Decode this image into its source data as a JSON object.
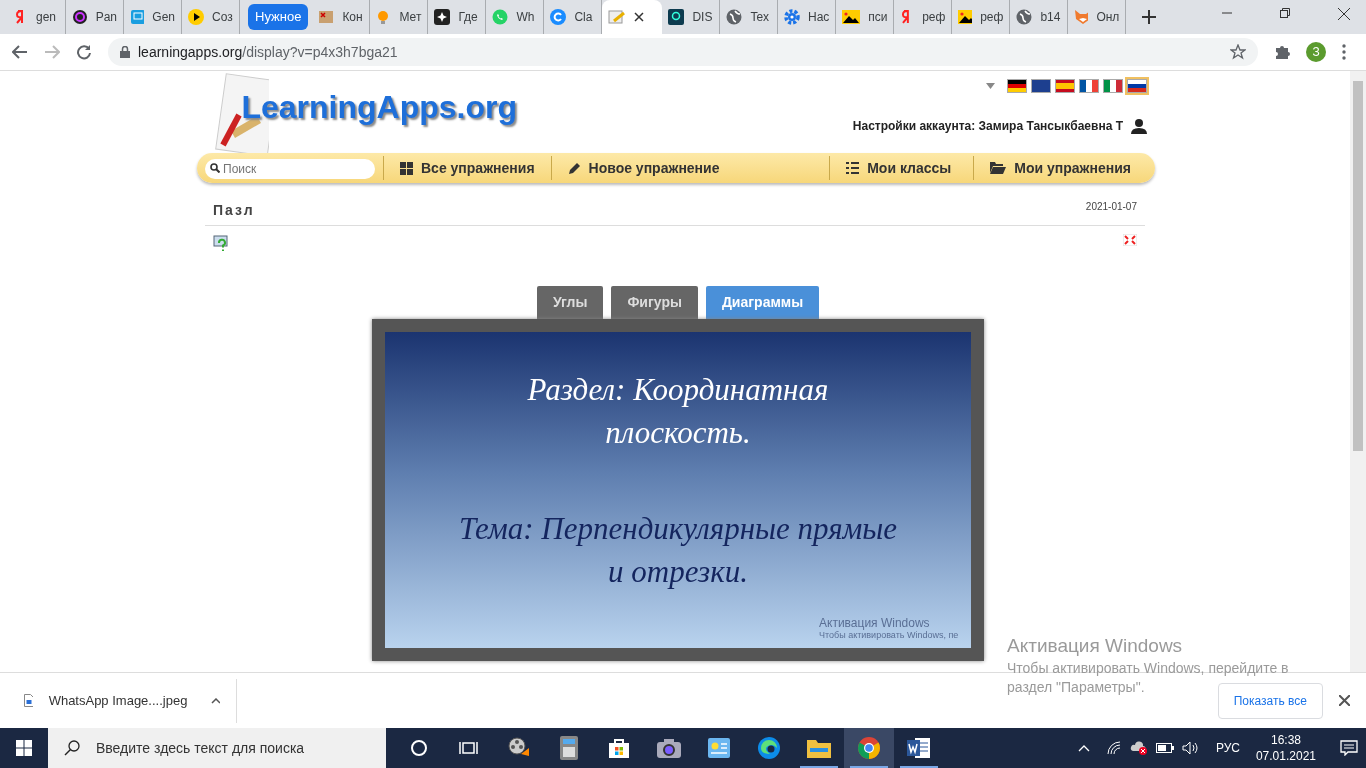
{
  "browser": {
    "tabs": [
      {
        "kind": "tab",
        "label": "gen",
        "selected": false
      },
      {
        "kind": "tab",
        "label": "Pan",
        "selected": false
      },
      {
        "kind": "tab",
        "label": "Gen",
        "selected": false
      },
      {
        "kind": "tab",
        "label": "Соз",
        "selected": false
      },
      {
        "kind": "group",
        "label": "Нужное"
      },
      {
        "kind": "tab",
        "label": "Кон",
        "selected": false
      },
      {
        "kind": "tab",
        "label": "Мет",
        "selected": false
      },
      {
        "kind": "tab",
        "label": "Где",
        "selected": false
      },
      {
        "kind": "tab",
        "label": "Wh",
        "selected": false
      },
      {
        "kind": "tab",
        "label": "Cla",
        "selected": false
      },
      {
        "kind": "tab",
        "selected": true
      },
      {
        "kind": "tab",
        "label": "DIS",
        "selected": false
      },
      {
        "kind": "tab",
        "label": "Tex",
        "selected": false
      },
      {
        "kind": "tab",
        "label": "Нас",
        "selected": false
      },
      {
        "kind": "tab",
        "label": "пси",
        "selected": false
      },
      {
        "kind": "tab",
        "label": "реф",
        "selected": false
      },
      {
        "kind": "tab",
        "label": "реф",
        "selected": false
      },
      {
        "kind": "tab",
        "label": "b14",
        "selected": false
      },
      {
        "kind": "tab",
        "label": "Онл",
        "selected": false
      }
    ],
    "url_host": "learningapps.org",
    "url_path": "/display?v=p4x3h7bga21",
    "profile_initial": "З"
  },
  "page": {
    "logo": "LearningApps.org",
    "languages": [
      {
        "selected": false
      },
      {
        "selected": false
      },
      {
        "selected": false
      },
      {
        "selected": false
      },
      {
        "selected": false
      },
      {
        "selected": true
      }
    ],
    "account": "Настройки аккаунта: Замира Тансыкбаевна Т",
    "search": {
      "placeholder": "Поиск"
    },
    "nav": [
      {
        "label": "Все упражнения"
      },
      {
        "label": "Новое упражнение"
      },
      {
        "label": "Мои классы"
      },
      {
        "label": "Мои упражнения"
      }
    ],
    "title": "Пазл",
    "date": "2021-01-07",
    "app_tabs": [
      {
        "label": "Углы",
        "selected": false
      },
      {
        "label": "Фигуры",
        "selected": false
      },
      {
        "label": "Диаграммы",
        "selected": true
      }
    ],
    "slide": {
      "heading": "Раздел: Координатная плоскость.",
      "topic": "Тема: Перпендикулярные прямые и отрезки.",
      "watermark_title": "Активация Windows",
      "watermark_text": "Чтобы активировать Windows, пе"
    }
  },
  "downloads": {
    "file": "WhatsApp Image....jpeg",
    "show_all": "Показать все"
  },
  "activation": {
    "title": "Активация Windows",
    "text": "Чтобы активировать Windows, перейдите в раздел \"Параметры\"."
  },
  "taskbar": {
    "search_placeholder": "Введите здесь текст для поиска",
    "apps": [
      {
        "running": false,
        "active": false
      },
      {
        "running": false,
        "active": false
      },
      {
        "running": false,
        "active": false
      },
      {
        "running": false,
        "active": false
      },
      {
        "running": false,
        "active": false
      },
      {
        "running": false,
        "active": false
      },
      {
        "running": false,
        "active": false
      },
      {
        "running": false,
        "active": false
      },
      {
        "running": true,
        "active": false
      },
      {
        "running": true,
        "active": true
      },
      {
        "running": true,
        "active": false
      }
    ],
    "language": "РУС",
    "time": "16:38",
    "date": "07.01.2021"
  }
}
